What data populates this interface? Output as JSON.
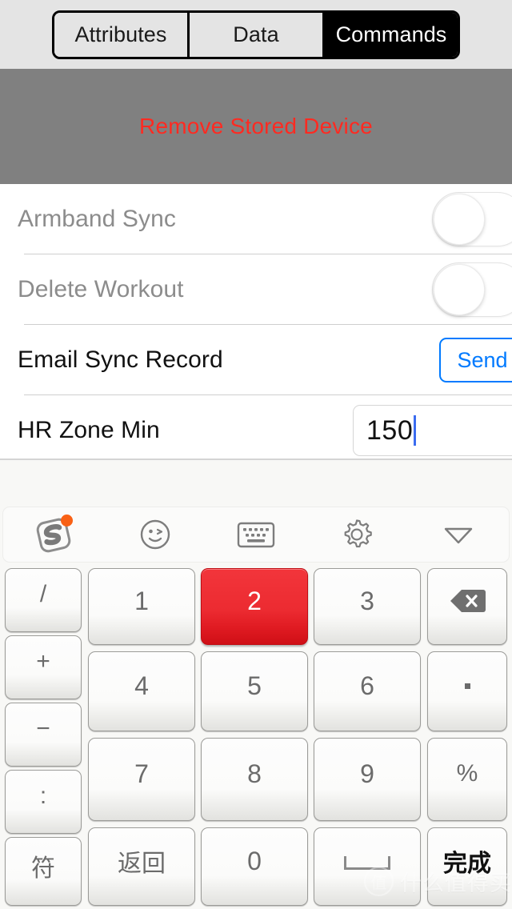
{
  "colors": {
    "accent_blue": "#007aff",
    "destructive_red": "#ff2a21",
    "pressed_key_red": "#e01b22",
    "band_gray": "#808080",
    "badge_orange": "#f96115",
    "caret_blue": "#3b6cf0"
  },
  "segmented_control": {
    "segments": [
      {
        "label": "Attributes",
        "selected": false
      },
      {
        "label": "Data",
        "selected": false
      },
      {
        "label": "Commands",
        "selected": true
      }
    ]
  },
  "banner": {
    "action_label": "Remove Stored Device"
  },
  "settings_rows": [
    {
      "label": "Armband Sync",
      "control": "switch",
      "value": "off",
      "disabled": true
    },
    {
      "label": "Delete Workout",
      "control": "switch",
      "value": "off",
      "disabled": true
    },
    {
      "label": "Email Sync Record",
      "control": "button",
      "button_label": "Send",
      "disabled": false
    },
    {
      "label": "HR Zone Min",
      "control": "textfield",
      "field_value": "150",
      "disabled": false
    }
  ],
  "keyboard": {
    "toolbar": [
      {
        "icon": "sogou-logo-icon",
        "badge": true
      },
      {
        "icon": "emoji-wink-icon",
        "badge": false
      },
      {
        "icon": "keyboard-icon",
        "badge": false
      },
      {
        "icon": "gear-icon",
        "badge": false
      },
      {
        "icon": "chevron-down-icon",
        "badge": false
      }
    ],
    "left_column": [
      "/",
      "+",
      "−",
      ":",
      "符"
    ],
    "digits": {
      "row1": [
        "1",
        "2",
        "3"
      ],
      "row2": [
        "4",
        "5",
        "6"
      ],
      "row3": [
        "7",
        "8",
        "9"
      ],
      "row4": [
        "返回",
        "0"
      ]
    },
    "right_column": [
      "backspace-icon",
      ".",
      "%",
      "完成"
    ],
    "space_label": "space-bar",
    "pressed_key": "2"
  },
  "watermark": {
    "mark": "值",
    "text": "什么值得买"
  }
}
